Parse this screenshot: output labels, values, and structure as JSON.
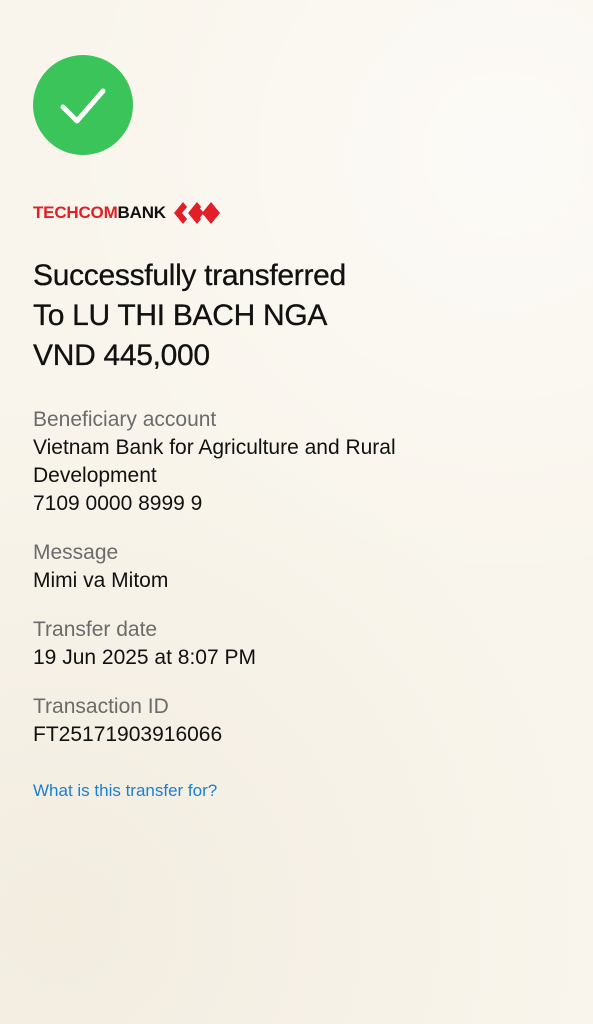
{
  "status": {
    "icon": "checkmark-icon",
    "color": "#3ac45a"
  },
  "brand": {
    "name_part1": "TECHCOM",
    "name_part2": "BANK",
    "logo": "techcombank-diamond-logo",
    "accent_color": "#e21f26"
  },
  "headline": {
    "line1": "Successfully transferred",
    "line2": "To LU THI BACH NGA",
    "line3": "VND 445,000"
  },
  "details": {
    "account": {
      "label": "Beneficiary account",
      "bank_line1": "Vietnam Bank for Agriculture and Rural",
      "bank_line2": "Development",
      "number": "7109 0000 8999 9"
    },
    "message": {
      "label": "Message",
      "value": "Mimi va Mitom"
    },
    "date": {
      "label": "Transfer date",
      "value": "19 Jun 2025 at 8:07 PM"
    },
    "transaction": {
      "label": "Transaction ID",
      "value": "FT25171903916066"
    }
  },
  "help_link": {
    "label": "What is this transfer for?",
    "color": "#1a7fd6"
  }
}
